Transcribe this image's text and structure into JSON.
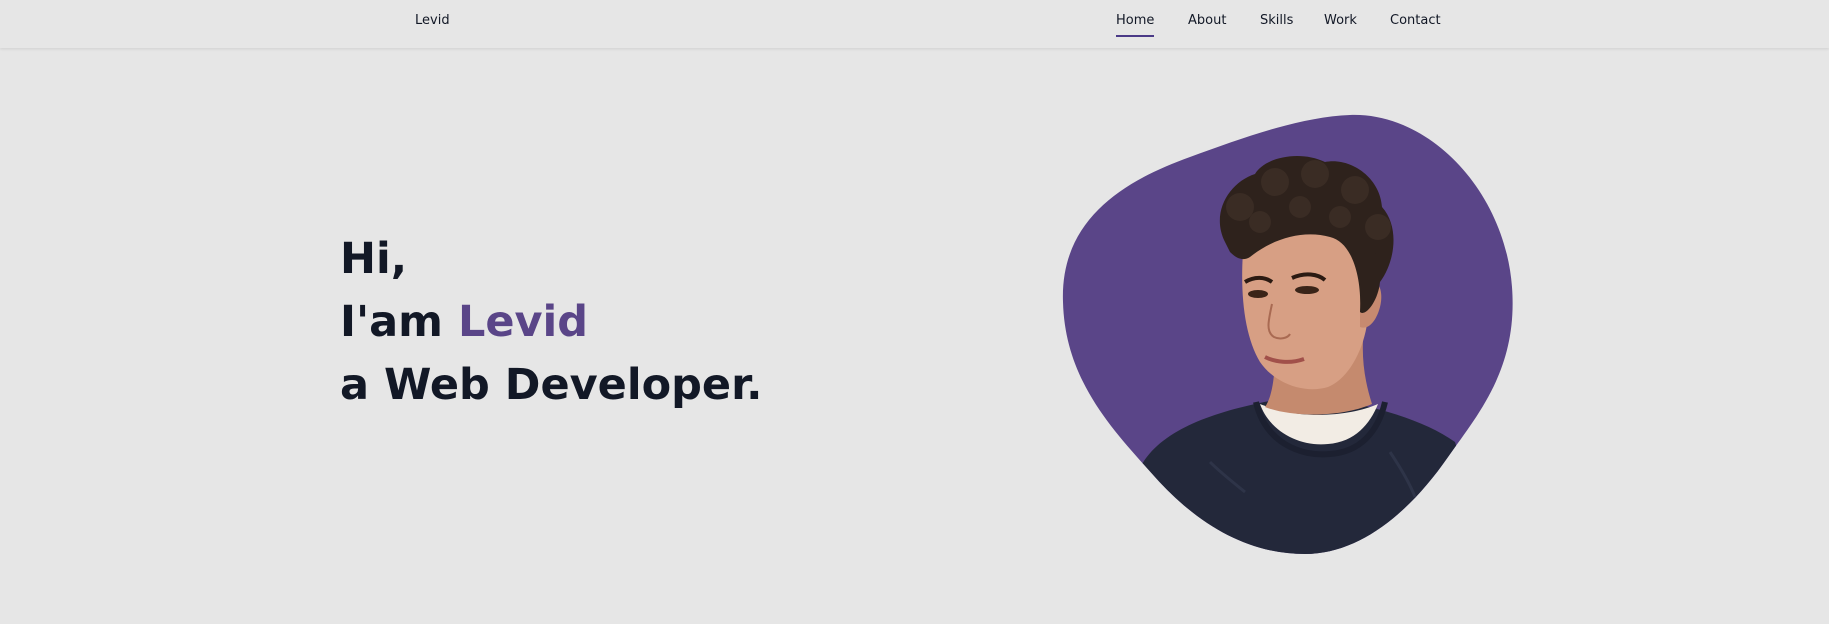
{
  "header": {
    "logo": "Levid",
    "nav": [
      {
        "label": "Home",
        "active": true
      },
      {
        "label": "About",
        "active": false
      },
      {
        "label": "Skills",
        "active": false
      },
      {
        "label": "Work",
        "active": false
      },
      {
        "label": "Contact",
        "active": false
      }
    ]
  },
  "hero": {
    "line1": "Hi,",
    "line2_prefix": "I'am ",
    "line2_name": "Levid",
    "line3": "a Web Developer."
  },
  "colors": {
    "background": "#e6e6e6",
    "accent": "#5a4588",
    "text": "#121826",
    "nav_underline": "#4b3a87"
  },
  "image": {
    "semantic": "profile-photo",
    "alt": ""
  }
}
